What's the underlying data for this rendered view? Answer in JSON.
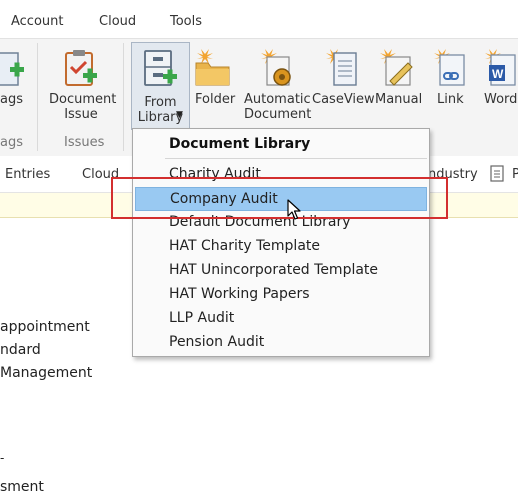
{
  "menubar": {
    "items": [
      "Account",
      "Cloud",
      "Tools"
    ]
  },
  "ribbon": {
    "buttons": [
      {
        "label": "ags",
        "icon": "tags-icon"
      },
      {
        "label": "Document\nIssue",
        "icon": "document-issue-icon"
      },
      {
        "label": "From\nLibrary",
        "icon": "from-library-icon"
      },
      {
        "label": "Folder",
        "icon": "folder-icon"
      },
      {
        "label": "Automatic\nDocument",
        "icon": "automatic-document-icon"
      },
      {
        "label": "CaseView",
        "icon": "caseview-icon"
      },
      {
        "label": "Manual",
        "icon": "manual-icon"
      },
      {
        "label": "Link",
        "icon": "link-icon"
      },
      {
        "label": "Word",
        "icon": "word-icon"
      }
    ],
    "groups": [
      "ags",
      "Issues"
    ]
  },
  "tabs": {
    "items": [
      "Entries",
      "Cloud"
    ],
    "industry": "ndustry"
  },
  "left_list": [
    "appointment",
    "ndard",
    "Management",
    "-",
    "sment"
  ],
  "dropdown": {
    "header": "Document Library",
    "items": [
      "Charity Audit",
      "Company Audit",
      "Default Document Library",
      "HAT Charity Template",
      "HAT Unincorporated Template",
      "HAT Working Papers",
      "LLP Audit",
      "Pension Audit"
    ],
    "selected_index": 1
  },
  "colors": {
    "selection": "#99c9f2",
    "highlight_box": "#d32f2f",
    "ribbon_bg": "#f4f4f4"
  }
}
